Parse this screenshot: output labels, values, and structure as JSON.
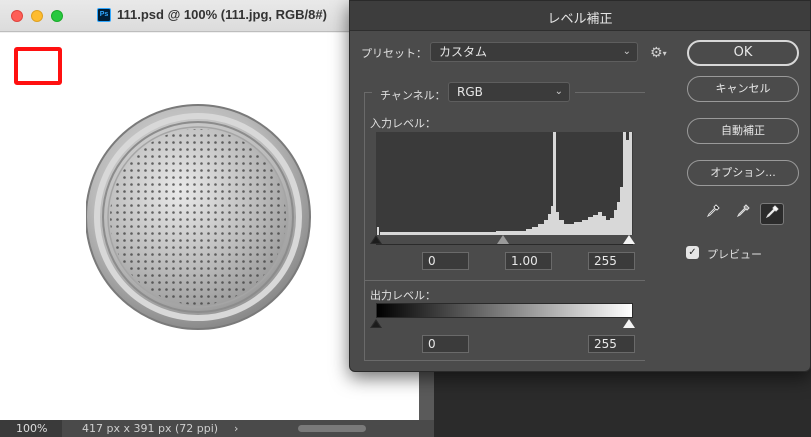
{
  "document": {
    "title": "111.psd @ 100% (111.jpg, RGB/8#)",
    "app_icon": "Ps",
    "zoom": "100%",
    "doc_size": "417 px x 391 px (72 ppi)",
    "status_arrow": "›"
  },
  "dialog": {
    "title": "レベル補正",
    "preset": {
      "label": "プリセット：",
      "value": "カスタム"
    },
    "channel": {
      "label": "チャンネル：",
      "value": "RGB"
    },
    "input_levels": {
      "label": "入力レベル：",
      "black": "0",
      "gamma": "1.00",
      "white": "255"
    },
    "output_levels": {
      "label": "出力レベル：",
      "black": "0",
      "white": "255"
    },
    "buttons": {
      "ok": "OK",
      "cancel": "キャンセル",
      "auto": "自動補正",
      "options": "オプション..."
    },
    "preview": {
      "label": "プレビュー",
      "checked": true,
      "check_glyph": "✓"
    },
    "eyedroppers": [
      "black-eyedropper-icon",
      "gray-eyedropper-icon",
      "white-eyedropper-icon"
    ],
    "gear_icon": "⚙",
    "gear_chevron": "▾",
    "dropdown_chevron": "⌄"
  },
  "colors": {
    "dialog_bg": "#4b4b4b",
    "annotation_red": "#ff1010",
    "histogram_bg": "#3a3a3a"
  }
}
